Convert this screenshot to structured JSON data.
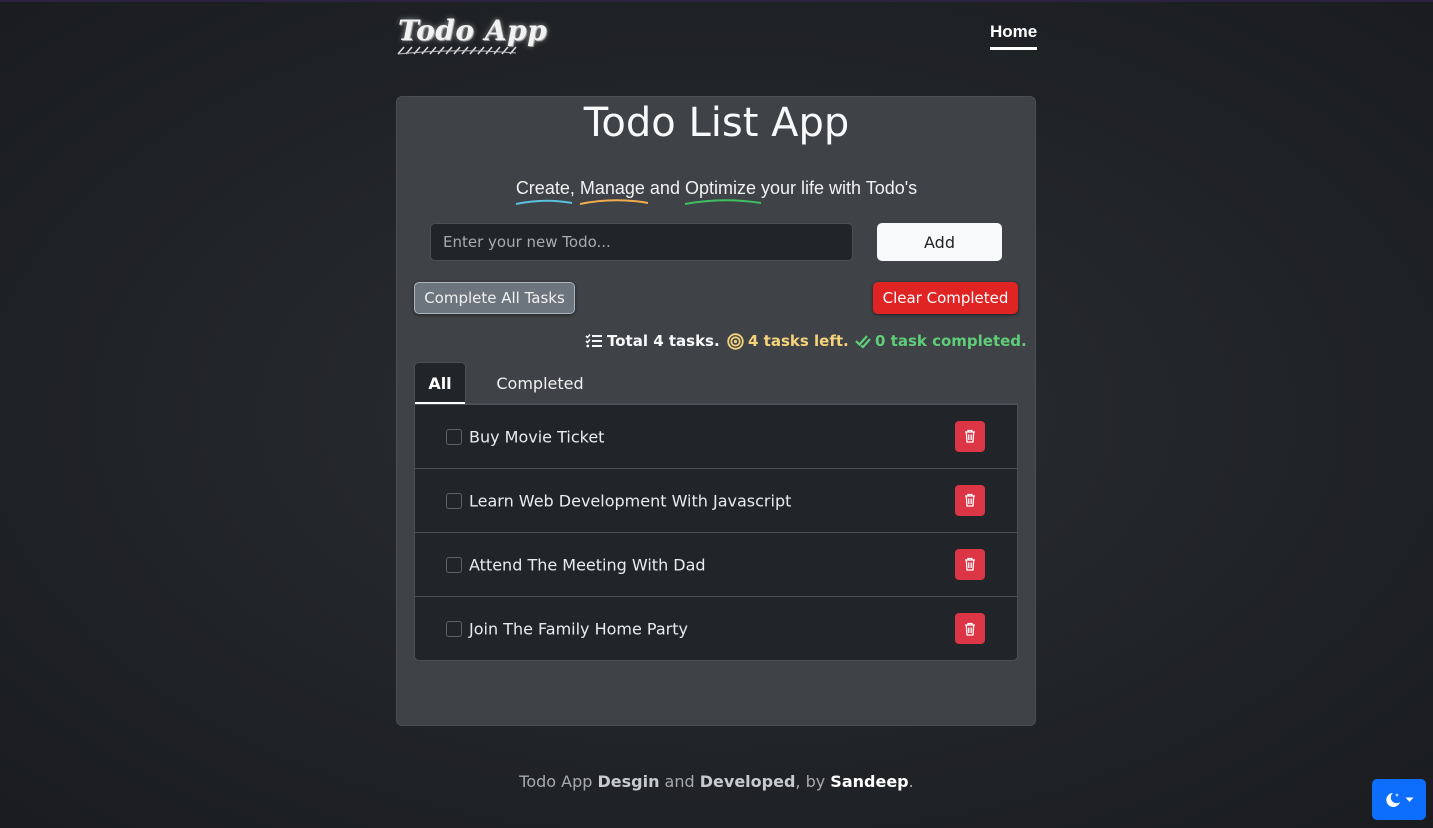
{
  "header": {
    "logo_text": "Todo App",
    "nav_home": "Home"
  },
  "main": {
    "title": "Todo List App",
    "subtitle": {
      "word1": "Create",
      "sep1": ", ",
      "word2": "Manage",
      "sep2": " and ",
      "word3": "Optimize",
      "rest": " your life with Todo's"
    },
    "input_placeholder": "Enter your new Todo...",
    "add_label": "Add",
    "complete_all_label": "Complete All Tasks",
    "clear_completed_label": "Clear Completed",
    "stats": {
      "total": "Total 4 tasks.",
      "left": "4 tasks left.",
      "completed": "0 task completed."
    },
    "tabs": [
      {
        "label": "All",
        "active": true
      },
      {
        "label": "Completed",
        "active": false
      }
    ],
    "todos": [
      {
        "text": "Buy Movie Ticket",
        "done": false
      },
      {
        "text": "Learn Web Development With Javascript",
        "done": false
      },
      {
        "text": "Attend The Meeting With Dad",
        "done": false
      },
      {
        "text": "Join The Family Home Party",
        "done": false
      }
    ]
  },
  "footer": {
    "part1": "Todo App ",
    "design": "Desgin",
    "part2": " and ",
    "developed": "Developed",
    "part3": ", by ",
    "author": "Sandeep",
    "part4": "."
  },
  "colors": {
    "underline_create": "#5bc0de",
    "underline_manage": "#f0ad4e",
    "underline_optimize": "#3fbf5f",
    "danger": "#dc3545",
    "primary": "#0d6efd"
  },
  "icons": {
    "list": "list-check-icon",
    "target": "bullseye-icon",
    "check": "check-double-icon",
    "trash": "trash-icon",
    "theme": "moon-stars-icon"
  }
}
